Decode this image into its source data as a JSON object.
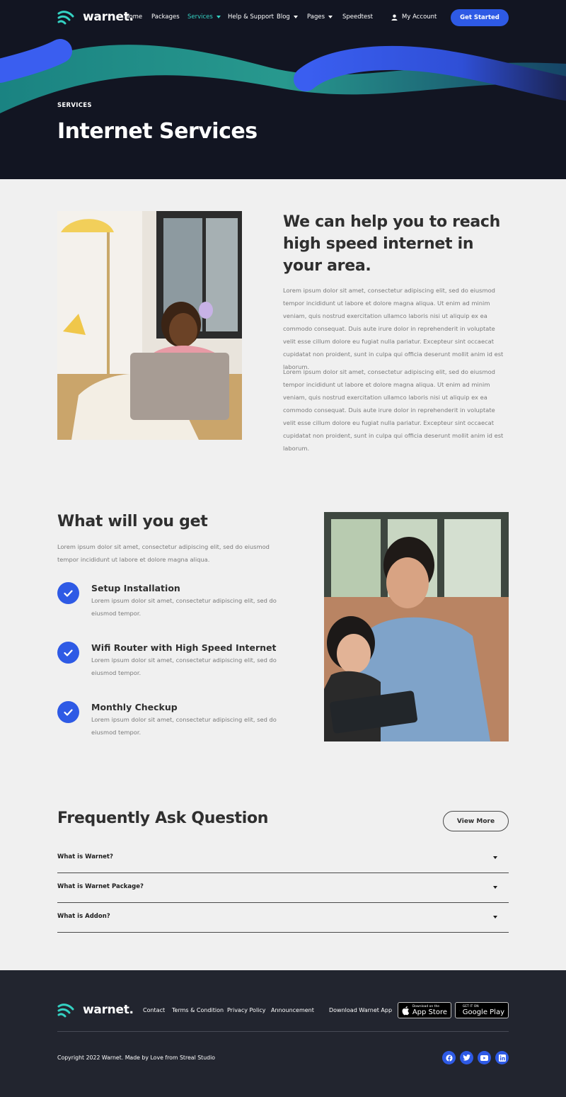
{
  "brand": {
    "name": "warnet.",
    "accent": "#2e5ae5",
    "teal": "#34d2c3",
    "dark": "#121522"
  },
  "nav": {
    "items": [
      {
        "label": "Home",
        "dropdown": false,
        "active": false
      },
      {
        "label": "Packages",
        "dropdown": false,
        "active": false
      },
      {
        "label": "Services",
        "dropdown": true,
        "active": true
      },
      {
        "label": "Help & Support",
        "dropdown": false,
        "active": false
      },
      {
        "label": "Blog",
        "dropdown": true,
        "active": false
      },
      {
        "label": "Pages",
        "dropdown": true,
        "active": false
      },
      {
        "label": "Speedtest",
        "dropdown": false,
        "active": false
      }
    ],
    "account_label": "My Account",
    "cta_label": "Get Started"
  },
  "hero": {
    "eyebrow": "SERVICES",
    "title": "Internet Services"
  },
  "intro": {
    "heading": "We can help you to reach high speed internet in your area.",
    "paragraphs": [
      "Lorem ipsum dolor sit amet, consectetur adipiscing elit, sed do eiusmod tempor incididunt ut labore et dolore magna aliqua. Ut enim ad minim veniam, quis nostrud exercitation ullamco laboris nisi ut aliquip ex ea commodo consequat. Duis aute irure dolor in reprehenderit in voluptate velit esse cillum dolore eu fugiat nulla pariatur. Excepteur sint occaecat cupidatat non proident, sunt in culpa qui officia deserunt mollit anim id est laborum.",
      "Lorem ipsum dolor sit amet, consectetur adipiscing elit, sed do eiusmod tempor incididunt ut labore et dolore magna aliqua. Ut enim ad minim veniam, quis nostrud exercitation ullamco laboris nisi ut aliquip ex ea commodo consequat. Duis aute irure dolor in reprehenderit in voluptate velit esse cillum dolore eu fugiat nulla pariatur. Excepteur sint occaecat cupidatat non proident, sunt in culpa qui officia deserunt mollit anim id est laborum."
    ]
  },
  "benefits": {
    "heading": "What will you get",
    "intro": "Lorem ipsum dolor sit amet, consectetur adipiscing elit, sed do eiusmod tempor incididunt ut labore et dolore magna aliqua.",
    "features": [
      {
        "title": "Setup Installation",
        "desc": "Lorem ipsum dolor sit amet, consectetur adipiscing elit, sed do eiusmod tempor."
      },
      {
        "title": "Wifi Router with High Speed Internet",
        "desc": "Lorem ipsum dolor sit amet, consectetur adipiscing elit, sed do eiusmod tempor."
      },
      {
        "title": "Monthly Checkup",
        "desc": "Lorem ipsum dolor sit amet, consectetur adipiscing elit, sed do eiusmod tempor."
      }
    ]
  },
  "faq": {
    "heading": "Frequently Ask Question",
    "more_label": "View More",
    "items": [
      {
        "question": "What is Warnet?"
      },
      {
        "question": "What is Warnet Package?"
      },
      {
        "question": "What is Addon?"
      }
    ]
  },
  "footer": {
    "logo": "warnet.",
    "links": [
      "Contact",
      "Terms & Condition",
      "Privacy Policy",
      "Announcement"
    ],
    "download_label": "Download Warnet App",
    "app_store": {
      "small": "Download on the",
      "big": "App Store"
    },
    "google_play": {
      "small": "GET IT ON",
      "big": "Google Play"
    },
    "copyright": "Copyright 2022 Warnet. Made by Love from Streal Studio",
    "socials": [
      "facebook-icon",
      "twitter-icon",
      "youtube-icon",
      "linkedin-icon"
    ]
  }
}
